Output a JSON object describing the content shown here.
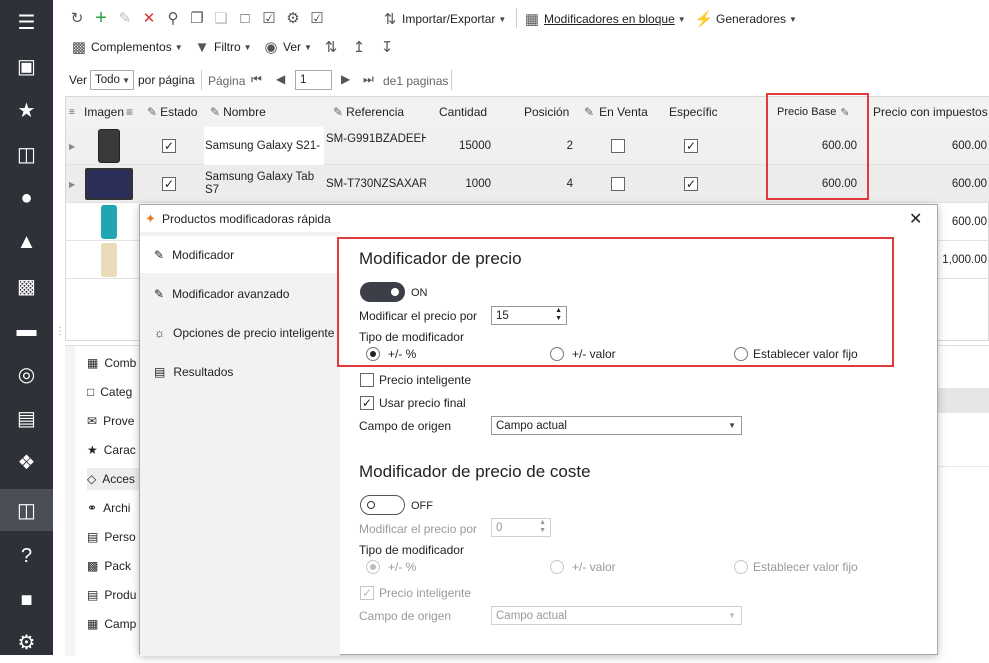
{
  "toolbar": {
    "import_export": "Importar/Exportar",
    "bulk_modifiers": "Modificadores en bloque",
    "generators": "Generadores",
    "addons": "Complementos",
    "filter": "Filtro",
    "view": "Ver"
  },
  "paging": {
    "view_label": "Ver",
    "per_page_value": "Todo",
    "per_page_label": "por página",
    "page_label": "Página",
    "page_value": "1",
    "of_pages": "de1 paginas"
  },
  "grid": {
    "headers": {
      "image": "Imagen",
      "state": "Estado",
      "name": "Nombre",
      "reference": "Referencia",
      "quantity": "Cantidad",
      "position": "Posición",
      "on_sale": "En Venta",
      "specific": "Específico",
      "base_price": "Precio Base",
      "price_tax": "Precio con impuestos"
    },
    "rows": [
      {
        "name": "Samsung Galaxy S21-",
        "reference": "SM-G991BZADEEH",
        "quantity": "15000",
        "position": "2",
        "base_price": "600.00",
        "price_tax": "600.00"
      },
      {
        "name": "Samsung Galaxy Tab S7",
        "reference": "SM-T730NZSAXAR",
        "quantity": "1000",
        "position": "4",
        "base_price": "600.00",
        "price_tax": "600.00"
      },
      {
        "price_tax": "600.00"
      },
      {
        "price_tax": "1,000.00"
      }
    ]
  },
  "lower_list": [
    "Comb",
    "Categ",
    "Prove",
    "Carac",
    "Acces",
    "Archi",
    "Perso",
    "Pack",
    "Produ",
    "Camp"
  ],
  "dialog": {
    "title": "Productos modificadoras rápida",
    "nav": [
      "Modificador",
      "Modificador avanzado",
      "Opciones de precio inteligente",
      "Resultados"
    ],
    "price": {
      "heading": "Modificador de precio",
      "toggle": "ON",
      "modify_label": "Modificar el precio por",
      "modify_value": "15",
      "type_label": "Tipo de modificador",
      "opt_percent": "+/- %",
      "opt_value": "+/- valor",
      "opt_fixed": "Establecer valor fijo",
      "smart": "Precio inteligente",
      "use_final": "Usar precio final",
      "source_label": "Campo de origen",
      "source_value": "Campo actual"
    },
    "cost": {
      "heading": "Modificador de precio de coste",
      "toggle": "OFF",
      "modify_label": "Modificar el precio por",
      "modify_value": "0",
      "type_label": "Tipo de modificador",
      "opt_percent": "+/- %",
      "opt_value": "+/- valor",
      "opt_fixed": "Establecer valor fijo",
      "smart": "Precio inteligente",
      "source_label": "Campo de origen",
      "source_value": "Campo actual"
    }
  },
  "colors": {
    "sidebar": "#2e3137",
    "accent": "#3c3f47",
    "highlight": "#e0393e"
  }
}
